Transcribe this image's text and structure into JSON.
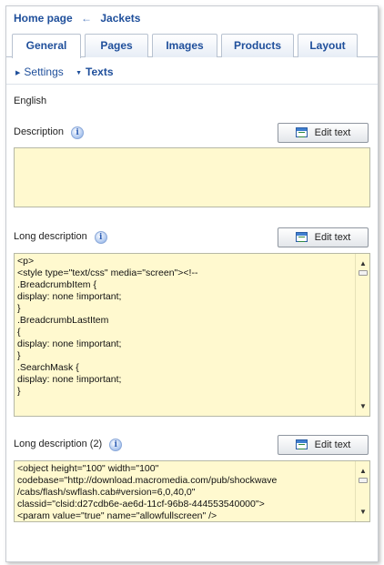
{
  "breadcrumb": {
    "home": "Home page",
    "separator": "←",
    "current": "Jackets"
  },
  "tabs": [
    {
      "label": "General",
      "active": true
    },
    {
      "label": "Pages",
      "active": false
    },
    {
      "label": "Images",
      "active": false
    },
    {
      "label": "Products",
      "active": false
    },
    {
      "label": "Layout",
      "active": false
    }
  ],
  "subnav": {
    "settings": "Settings",
    "texts": "Texts"
  },
  "language": "English",
  "fields": {
    "description": {
      "label": "Description",
      "button": "Edit text",
      "value": ""
    },
    "long_description": {
      "label": "Long description",
      "button": "Edit text",
      "value": "<p>\n<style type=\"text/css\" media=\"screen\"><!--\n.BreadcrumbItem {\ndisplay: none !important;\n}\n.BreadcrumbLastItem\n{\ndisplay: none !important;\n}\n.SearchMask {\ndisplay: none !important;\n}"
    },
    "long_description_2": {
      "label": "Long description (2)",
      "button": "Edit text",
      "value": "<object height=\"100\" width=\"100\"\ncodebase=\"http://download.macromedia.com/pub/shockwave\n/cabs/flash/swflash.cab#version=6,0,40,0\"\nclassid=\"clsid:d27cdb6e-ae6d-11cf-96b8-444553540000\">\n<param value=\"true\" name=\"allowfullscreen\" />"
    }
  },
  "colors": {
    "link": "#1f4f9b",
    "textarea_bg": "#fff9cf"
  }
}
